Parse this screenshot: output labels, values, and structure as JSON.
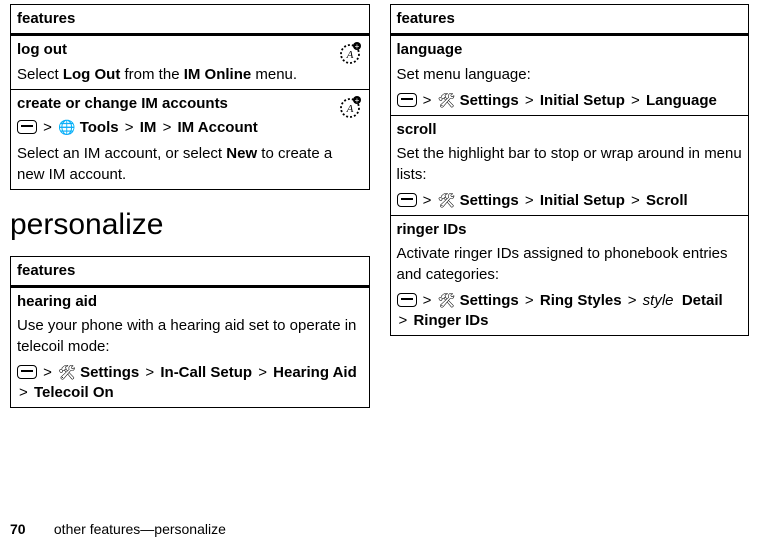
{
  "left": {
    "table1": {
      "header": "features",
      "row1": {
        "title": "log out",
        "text_pre": "Select ",
        "cmd1": "Log Out",
        "text_mid": " from the ",
        "cmd2": "IM Online",
        "text_post": " menu."
      },
      "row2": {
        "title": "create or change IM accounts",
        "path": {
          "p1": "Tools",
          "p2": "IM",
          "p3": "IM Account"
        },
        "text_pre": "Select an IM account, or select ",
        "cmd1": "New",
        "text_post": " to create a new IM account."
      }
    },
    "heading": "personalize",
    "table2": {
      "header": "features",
      "row1": {
        "title": "hearing aid",
        "text": "Use your phone with a hearing aid set to operate in telecoil mode:",
        "path": {
          "p1": "Settings",
          "p2": "In-Call Setup",
          "p3": "Hearing Aid",
          "p4": "Telecoil On"
        }
      }
    }
  },
  "right": {
    "table": {
      "header": "features",
      "row1": {
        "title": "language",
        "text": "Set menu language:",
        "path": {
          "p1": "Settings",
          "p2": "Initial Setup",
          "p3": "Language"
        }
      },
      "row2": {
        "title": "scroll",
        "text": "Set the highlight bar to stop or wrap around in menu lists:",
        "path": {
          "p1": "Settings",
          "p2": "Initial Setup",
          "p3": "Scroll"
        }
      },
      "row3": {
        "title": "ringer IDs",
        "text": "Activate ringer IDs assigned to phonebook entries and categories:",
        "path": {
          "p1": "Settings",
          "p2": "Ring Styles",
          "styleword": "style",
          "p3": "Detail",
          "p4": "Ringer IDs"
        }
      }
    }
  },
  "footer": {
    "page": "70",
    "text": "other features—personalize"
  },
  "gt": ">"
}
